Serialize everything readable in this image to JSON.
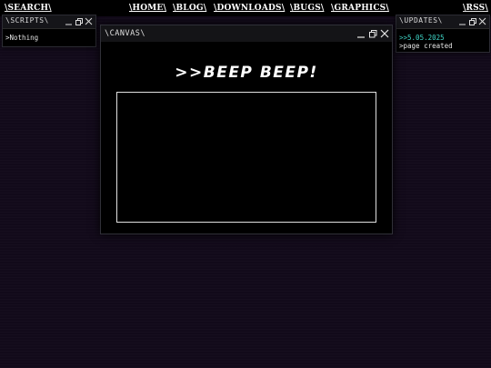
{
  "nav": {
    "search": "\\SEARCH\\",
    "home": "\\HOME\\",
    "blog": "\\BLOG\\",
    "downloads": "\\DOWNLOADS\\",
    "bugs": "\\BUGS\\",
    "graphics": "\\GRAPHICS\\",
    "rss": "\\RSS\\"
  },
  "scripts_window": {
    "title": "\\SCRIPTS\\",
    "content": ">Nothing"
  },
  "updates_window": {
    "title": "\\UPDATES\\",
    "date": ">>5.05.2025",
    "entry": ">page created"
  },
  "canvas_window": {
    "title": "\\CANVAS\\",
    "headline": ">>BEEP BEEP!"
  },
  "icons": {
    "minimize": "minimize-icon",
    "restore": "restore-icon",
    "close": "close-icon"
  },
  "colors": {
    "background": "#120a1a",
    "date_accent": "#3fd6c8",
    "window_bg": "#000000"
  }
}
